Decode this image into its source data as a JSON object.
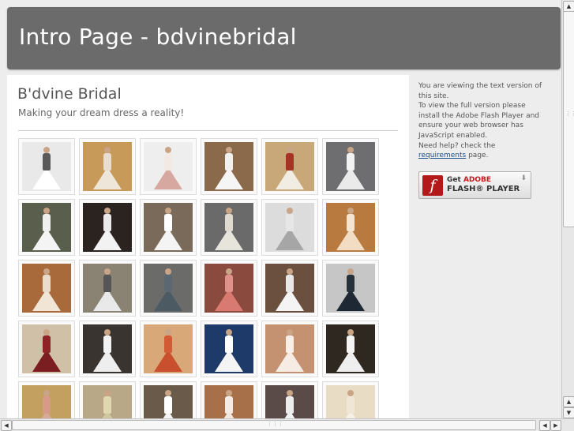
{
  "header": {
    "title": "Intro Page - bdvinebridal"
  },
  "main": {
    "site_title": "B'dvine Bridal",
    "tagline": "Making your dream dress a reality!",
    "thumbnails": [
      {
        "bg": "#e9e9e9",
        "dress": "#ffffff",
        "bodice": "#5a5a5a"
      },
      {
        "bg": "#c79a5a",
        "dress": "#efe6da",
        "bodice": "#e8ddd0"
      },
      {
        "bg": "#eeeeee",
        "dress": "#d7a8a0",
        "bodice": "#f2e8e4"
      },
      {
        "bg": "#8a6a4a",
        "dress": "#f5f5f5",
        "bodice": "#f0f0f0"
      },
      {
        "bg": "#c8a878",
        "dress": "#f2ede2",
        "bodice": "#a83226"
      },
      {
        "bg": "#6e6e70",
        "dress": "#eaeaea",
        "bodice": "#f2f2f2"
      },
      {
        "bg": "#5a5e4c",
        "dress": "#f4f4f4",
        "bodice": "#efefef"
      },
      {
        "bg": "#2a2320",
        "dress": "#f2f2f2",
        "bodice": "#e9e9e9"
      },
      {
        "bg": "#7a6a5a",
        "dress": "#f4f4f4",
        "bodice": "#ffffff"
      },
      {
        "bg": "#6a6a6a",
        "dress": "#e7e4dc",
        "bodice": "#dedad0"
      },
      {
        "bg": "#dcdcdc",
        "dress": "#a6a6a6",
        "bodice": "#e6e6e6"
      },
      {
        "bg": "#b87a3e",
        "dress": "#f2dcc4",
        "bodice": "#f4e4d0"
      },
      {
        "bg": "#a86a3a",
        "dress": "#f1e6d6",
        "bodice": "#eadccc"
      },
      {
        "bg": "#8a8272",
        "dress": "#e9e9e9",
        "bodice": "#555555"
      },
      {
        "bg": "#6b6c6a",
        "dress": "#4c5a64",
        "bodice": "#5b6872"
      },
      {
        "bg": "#8a4a3e",
        "dress": "#d87a72",
        "bodice": "#e0918a"
      },
      {
        "bg": "#6b5040",
        "dress": "#f4f4f4",
        "bodice": "#e8e8e8"
      },
      {
        "bg": "#c6c6c6",
        "dress": "#1e2834",
        "bodice": "#27313c"
      },
      {
        "bg": "#d0c0a8",
        "dress": "#7a1e22",
        "bodice": "#8f2428"
      },
      {
        "bg": "#3a3430",
        "dress": "#eeeeee",
        "bodice": "#f2f2f2"
      },
      {
        "bg": "#d8a878",
        "dress": "#c8502e",
        "bodice": "#d25a34"
      },
      {
        "bg": "#1e3a68",
        "dress": "#f4f4f4",
        "bodice": "#ffffff"
      },
      {
        "bg": "#c49270",
        "dress": "#f6ece4",
        "bodice": "#f8f0e8"
      },
      {
        "bg": "#2e2820",
        "dress": "#eeeeee",
        "bodice": "#f4f4f4"
      },
      {
        "bg": "#c4a060",
        "dress": "#d8a898",
        "bodice": "#d89a88"
      },
      {
        "bg": "#b8a888",
        "dress": "#d0c8a0",
        "bodice": "#e0d8b0"
      },
      {
        "bg": "#6a5a4a",
        "dress": "#f4f4f4",
        "bodice": "#ffffff"
      },
      {
        "bg": "#a87048",
        "dress": "#f2e8e0",
        "bodice": "#f4ece4"
      },
      {
        "bg": "#5a4a48",
        "dress": "#f2f2f2",
        "bodice": "#ededed"
      },
      {
        "bg": "#e8dcc4",
        "dress": "#f6f0e6",
        "bodice": "#f0e6d6"
      }
    ]
  },
  "sidebar": {
    "line1": "You are viewing the text version of this site.",
    "line2": "To view the full version please install the Adobe Flash Player and ensure your web browser has JavaScript enabled.",
    "help_prefix": "Need help? check the ",
    "help_link": "requirements",
    "help_suffix": " page.",
    "flash_get": "Get ",
    "flash_adobe": "ADOBE",
    "flash_player": "FLASH® PLAYER"
  },
  "icons": {
    "flash_logo": "flash-logo-icon",
    "download_arrow": "download-arrow-icon",
    "scroll_up": "arrow-up-icon",
    "scroll_down": "arrow-down-icon",
    "scroll_left": "arrow-left-icon",
    "scroll_right": "arrow-right-icon"
  }
}
